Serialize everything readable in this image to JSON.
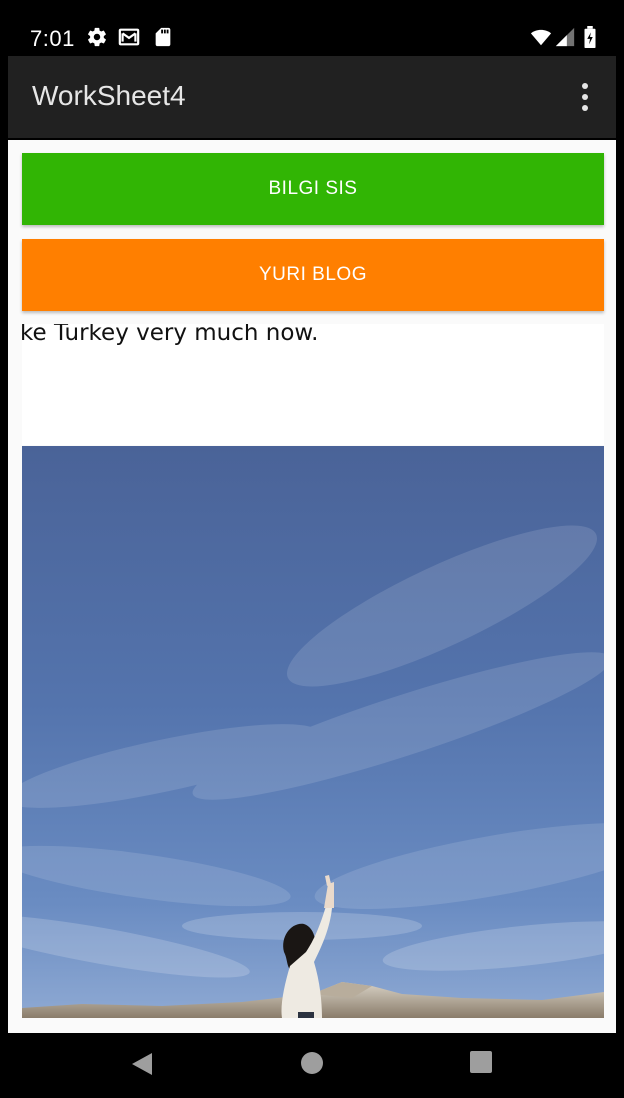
{
  "status_bar": {
    "time": "7:01",
    "icons": [
      "settings-icon",
      "gmail-icon",
      "sd-card-icon",
      "wifi-icon",
      "cell-signal-icon",
      "battery-icon"
    ]
  },
  "app_bar": {
    "title": "WorkSheet4",
    "overflow_icon": "more-vert-icon"
  },
  "buttons": {
    "bilgi": {
      "label": "BILGI SIS",
      "color": "#31b504"
    },
    "yuri": {
      "label": "YURI BLOG",
      "color": "#ff7f00"
    }
  },
  "webview": {
    "text": "ke Turkey very much now."
  },
  "photo": {
    "subject": "woman-pointing-at-sky-photo"
  },
  "nav_bar": {
    "icons": [
      "back-icon",
      "home-icon",
      "recents-icon"
    ]
  },
  "colors": {
    "app_bar": "#212121",
    "status_bar": "#000000",
    "sky": "#4f6ba6"
  }
}
